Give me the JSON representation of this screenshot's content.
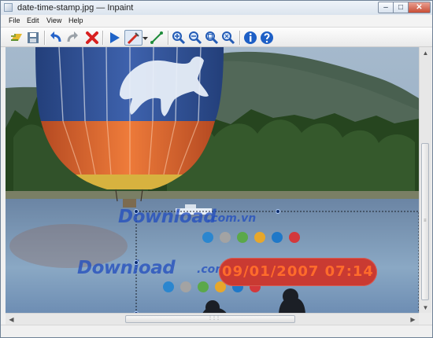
{
  "window": {
    "title": "date-time-stamp.jpg — Inpaint",
    "buttons": {
      "minimize": "–",
      "maximize": "□",
      "close": "✕"
    }
  },
  "menu": [
    "File",
    "Edit",
    "View",
    "Help"
  ],
  "toolbar": {
    "icons": [
      "open-icon",
      "save-icon",
      "undo-icon",
      "redo-icon",
      "cancel-icon",
      "run-icon",
      "marker-icon",
      "dropdown-arrow-icon",
      "line-tool-icon",
      "zoom-in-icon",
      "zoom-out-icon",
      "zoom-fit-icon",
      "zoom-actual-icon",
      "info-icon",
      "help-icon"
    ]
  },
  "image": {
    "timestamp": "09/01/2007 07:14",
    "watermark_text": "Download",
    "watermark_domain": ".com.vn",
    "dot_colors": [
      "#2b86cf",
      "#a3a3a3",
      "#5ba84a",
      "#e7a72b",
      "#1f78c8",
      "#d3383b"
    ]
  },
  "accent": "#2d72d2"
}
